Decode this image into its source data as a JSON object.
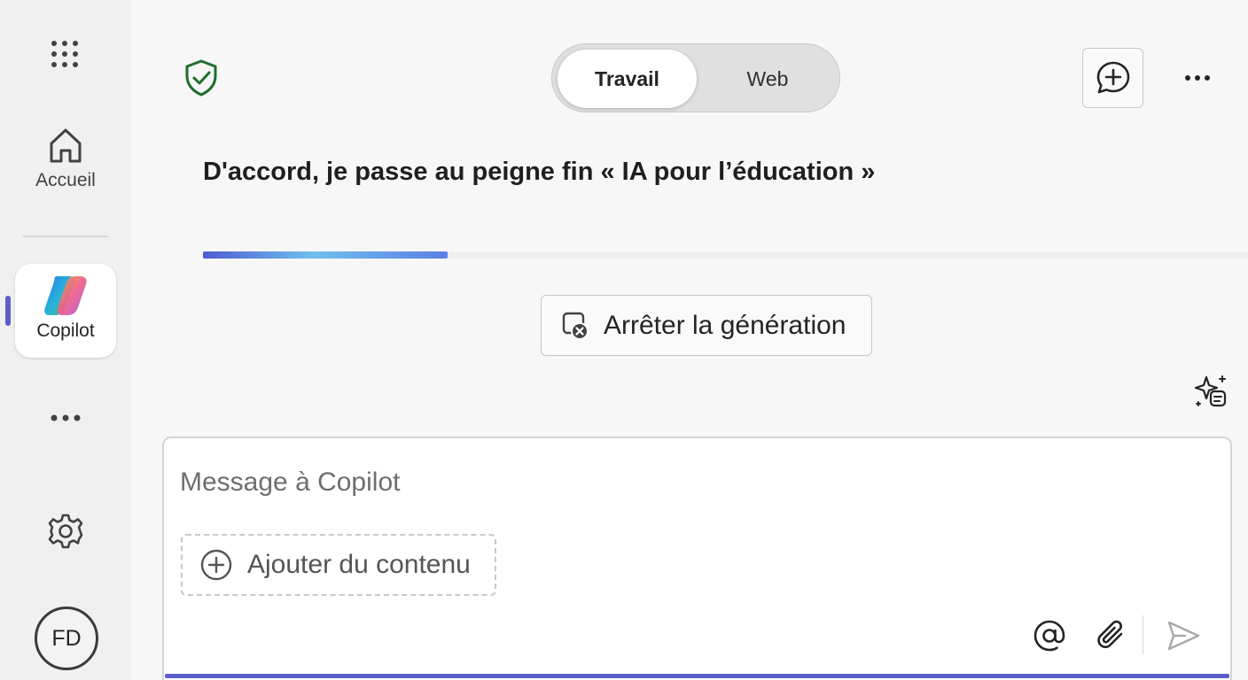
{
  "rail": {
    "home_label": "Accueil",
    "copilot_label": "Copilot",
    "avatar_initials": "FD",
    "active_indicator_color": "#5b5fc7"
  },
  "header": {
    "modes": [
      "Travail",
      "Web"
    ],
    "selected_mode": "Travail"
  },
  "response": {
    "status_text": "D'accord, je passe au peigne fin « IA pour l’éducation »",
    "progress": 0.234,
    "stop_label": "Arrêter la génération"
  },
  "composer": {
    "placeholder": "Message à Copilot",
    "value": "",
    "add_content_label": "Ajouter du contenu"
  },
  "icons": {
    "apps": "app-launcher-grid-icon",
    "home": "home-icon",
    "copilot": "copilot-logo",
    "more": "more-horizontal-icon",
    "settings": "gear-icon",
    "shield": "shield-check-icon",
    "new_chat": "chat-add-icon",
    "stop": "stop-generation-icon",
    "prompts": "sparkle-prompts-icon",
    "add": "circle-plus-icon",
    "mention": "at-sign-icon",
    "attach": "paperclip-icon",
    "send": "send-icon"
  },
  "colors": {
    "accent": "#5b5fc7",
    "shield": "#1e6e2a"
  }
}
